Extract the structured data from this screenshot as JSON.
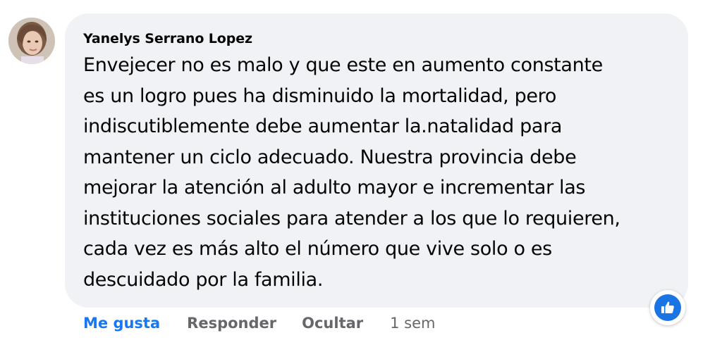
{
  "comment": {
    "author": "Yanelys Serrano Lopez",
    "text": "Envejecer no es malo y que este en aumento constante\nes un logro pues ha disminuido la mortalidad, pero\nindiscutiblemente debe aumentar la.natalidad para\nmantener un ciclo adecuado. Nuestra provincia debe\nmejorar la atención al adulto mayor e incrementar las\ninstituciones sociales para atender a los que lo requieren,\ncada vez es más alto el número que vive solo o es\ndescuidado por la familia.",
    "avatar_icon": "user-avatar-photo"
  },
  "actions": {
    "like_label": "Me gusta",
    "reply_label": "Responder",
    "hide_label": "Ocultar",
    "timestamp": "1 sem"
  },
  "reaction": {
    "icon": "like-thumbs-up-icon",
    "color": "#1b74e4"
  }
}
